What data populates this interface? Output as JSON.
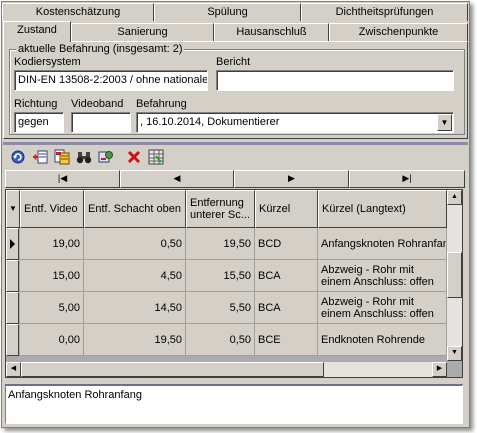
{
  "tabs_back": [
    "Kostenschätzung",
    "Spülung",
    "Dichtheitsprüfungen"
  ],
  "tabs_front": [
    "Zustand",
    "Sanierung",
    "Hausanschluß",
    "Zwischenpunkte"
  ],
  "group": {
    "title": "aktuelle Befahrung (insgesamt: 2)",
    "kodiersystem_label": "Kodiersystem",
    "kodiersystem_value": "DIN-EN 13508-2:2003 / ohne nationale",
    "bericht_label": "Bericht",
    "bericht_value": "",
    "richtung_label": "Richtung",
    "richtung_value": "gegen",
    "videoband_label": "Videoband",
    "videoband_value": "",
    "befahrung_label": "Befahrung",
    "befahrung_value": ", 16.10.2014, Dokumentierer"
  },
  "toolbar_icons": [
    "refresh-icon",
    "add-record-icon",
    "edit-record-icon",
    "binoculars-icon",
    "settings-icon",
    "delete-icon",
    "grid-view-icon"
  ],
  "nav": [
    "|◀",
    "◀",
    "▶",
    "▶|"
  ],
  "grid": {
    "columns": [
      "Entf. Video",
      "Entf. Schacht oben",
      "Entfernung unterer Sc...",
      "Kürzel",
      "Kürzel (Langtext)"
    ],
    "rows": [
      {
        "entf_video": "19,00",
        "entf_schacht": "0,50",
        "entf_unten": "19,50",
        "kuerzel": "BCD",
        "langtext": "Anfangsknoten Rohranfang",
        "current": true
      },
      {
        "entf_video": "15,00",
        "entf_schacht": "4,50",
        "entf_unten": "15,50",
        "kuerzel": "BCA",
        "langtext": "Abzweig - Rohr mit einem Anschluss: offen",
        "current": false
      },
      {
        "entf_video": "5,00",
        "entf_schacht": "14,50",
        "entf_unten": "5,50",
        "kuerzel": "BCA",
        "langtext": "Abzweig - Rohr mit einem Anschluss: offen",
        "current": false
      },
      {
        "entf_video": "0,00",
        "entf_schacht": "19,50",
        "entf_unten": "0,50",
        "kuerzel": "BCE",
        "langtext": "Endknoten Rohrende",
        "current": false
      }
    ]
  },
  "memo": "Anfangsknoten Rohranfang"
}
